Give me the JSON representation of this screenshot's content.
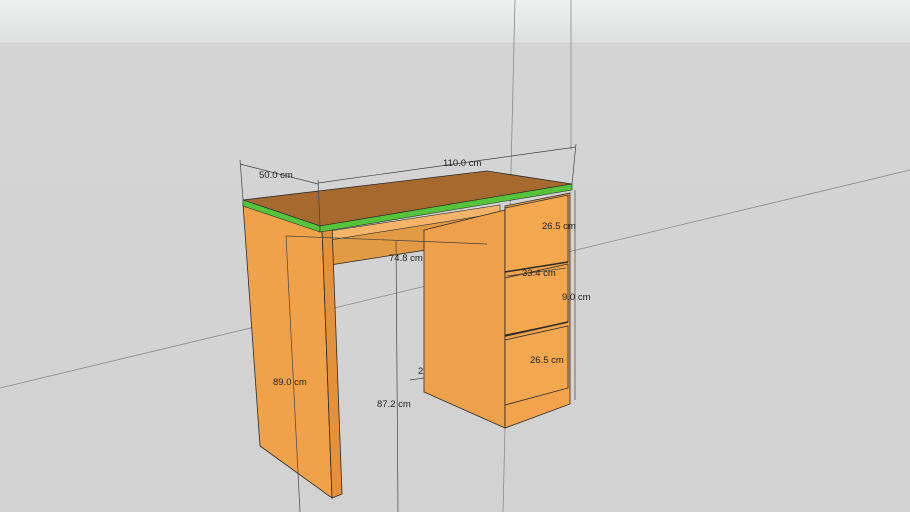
{
  "model": {
    "name": "Desk with drawers",
    "colors": {
      "sky": "#e9ebeb",
      "ground": "#d3d3d3",
      "wood_front": "#f0a24a",
      "wood_side": "#e8953c",
      "wood_top": "#a86a2e",
      "top_edge_green": "#55c43b",
      "outline": "#2a2a2a",
      "dimension_line": "#444444"
    }
  },
  "dimensions": {
    "depth": "50.0 cm",
    "width": "110.0 cm",
    "drawer_top_height": "26.5 cm",
    "knee_width": "74.8 cm",
    "drawer_width": "33.4 cm",
    "drawer_middle_height": "9.0 cm",
    "drawer_bottom_height": "26.5 cm",
    "leg_height": "89.0 cm",
    "knee_height": "87.2 cm",
    "partial_label": "2"
  }
}
